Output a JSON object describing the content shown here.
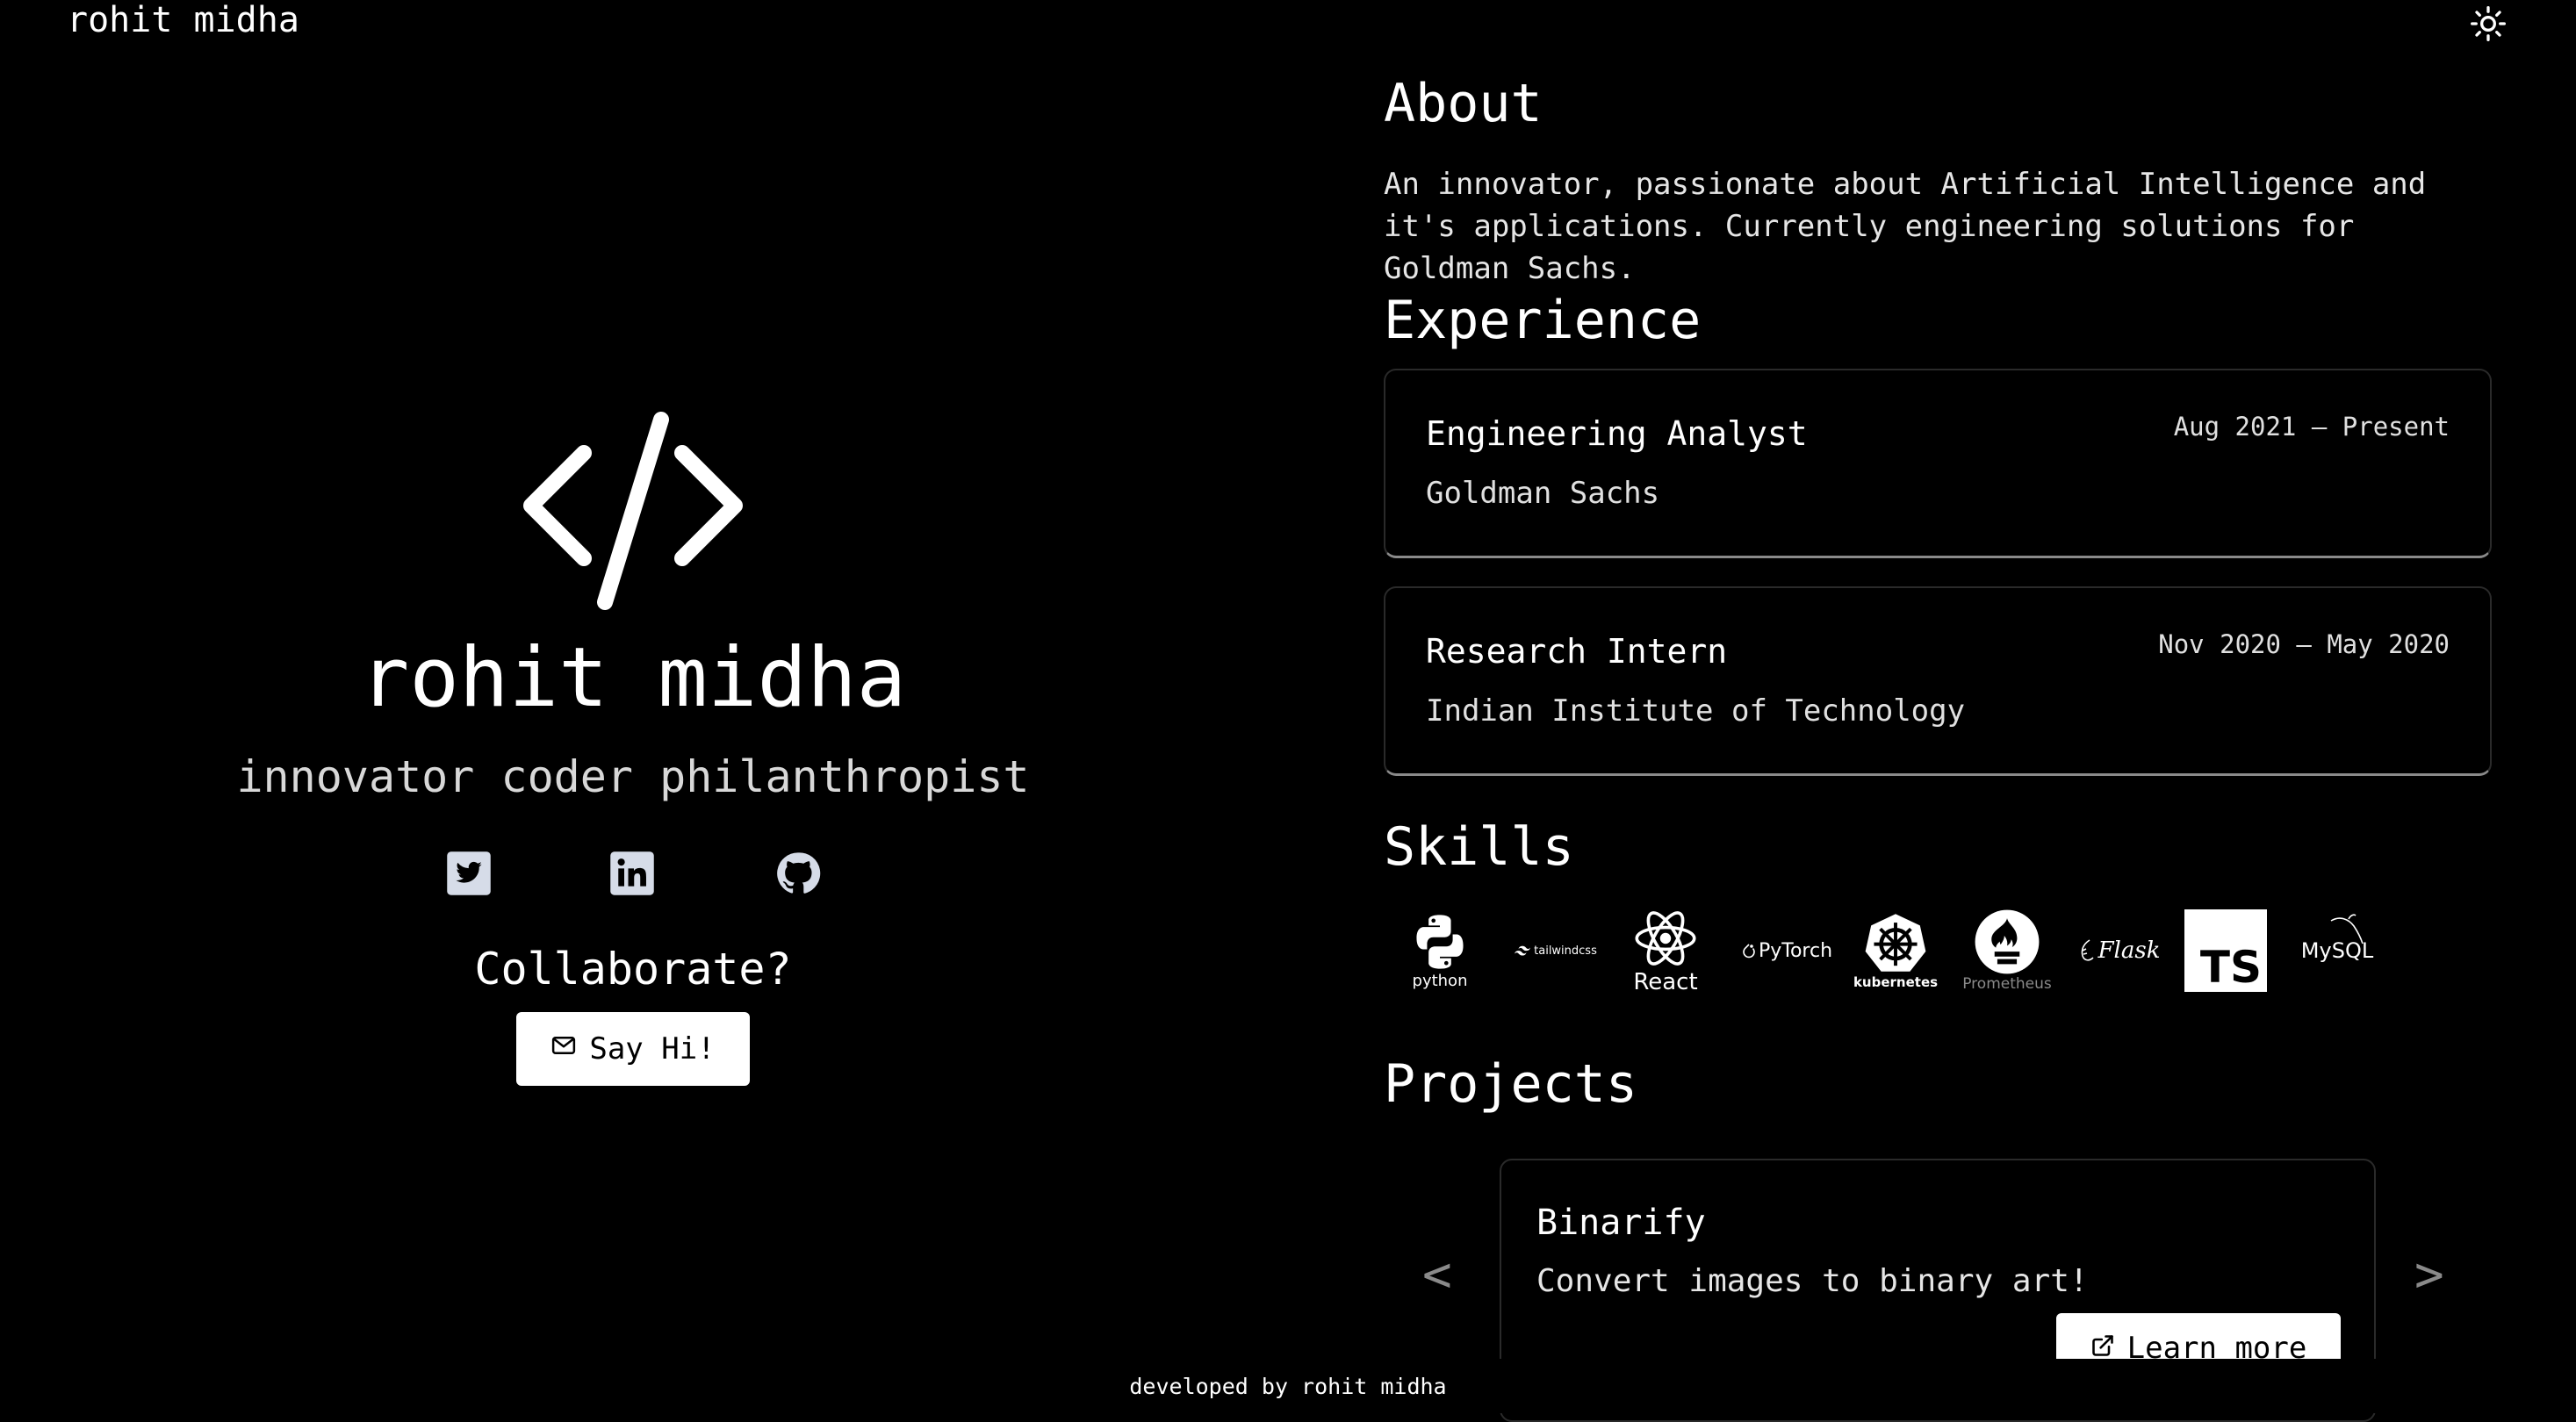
{
  "nav": {
    "brand": "rohit midha"
  },
  "hero": {
    "name": "rohit midha",
    "tagline": "innovator coder philanthropist",
    "collab_prompt": "Collaborate?",
    "say_hi_label": "Say Hi!"
  },
  "about": {
    "title": "About",
    "text": "An innovator, passionate about Artificial Intelligence and it's applications. Currently engineering solutions for Goldman Sachs."
  },
  "experience": {
    "title": "Experience",
    "items": [
      {
        "role": "Engineering Analyst",
        "company": "Goldman Sachs",
        "dates": "Aug 2021 – Present"
      },
      {
        "role": "Research Intern",
        "company": "Indian Institute of Technology",
        "dates": "Nov 2020 – May 2020"
      }
    ]
  },
  "skills": {
    "title": "Skills",
    "items": [
      {
        "name": "python",
        "icon": "python-icon"
      },
      {
        "name": "tailwindcss",
        "icon": "tailwindcss-icon"
      },
      {
        "name": "React",
        "icon": "react-icon"
      },
      {
        "name": "PyTorch",
        "icon": "pytorch-icon"
      },
      {
        "name": "kubernetes",
        "icon": "kubernetes-icon"
      },
      {
        "name": "Prometheus",
        "icon": "prometheus-icon"
      },
      {
        "name": "Flask",
        "icon": "flask-icon"
      },
      {
        "name": "TS",
        "icon": "typescript-icon"
      },
      {
        "name": "MySQL",
        "icon": "mysql-icon"
      }
    ]
  },
  "projects": {
    "title": "Projects",
    "prev_label": "<",
    "next_label": ">",
    "items": [
      {
        "name": "Binarify",
        "description": "Convert images to binary art!",
        "cta": "Learn more"
      }
    ]
  },
  "footer": {
    "text": "developed by rohit midha"
  },
  "colors": {
    "background": "#000000",
    "text": "#ffffff",
    "button_bg": "#ffffff",
    "muted": "#8a8a8a"
  }
}
